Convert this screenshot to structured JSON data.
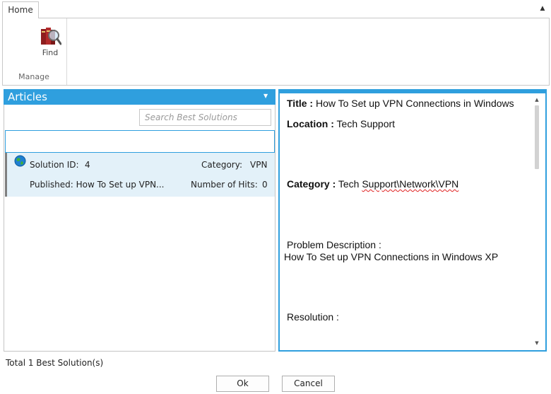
{
  "ribbon": {
    "tabs": [
      "Home"
    ],
    "collapse_icon": "chevron-up-icon",
    "find_label": "Find",
    "find_icon": "books-magnifier-icon",
    "group_label": "Manage"
  },
  "articles": {
    "header": "Articles",
    "header_color": "#2f9fde",
    "search_placeholder": "Search Best Solutions",
    "search_value": "",
    "selected_row": {
      "icon": "globe-icon",
      "solution_id_label": "Solution ID:",
      "solution_id": "4",
      "category_label": "Category:",
      "category": "VPN",
      "published": "Published: How To Set up VPN...",
      "hits_label": "Number of Hits:",
      "hits": "0",
      "background": "#e3f1f9"
    }
  },
  "detail": {
    "title_label": "Title :",
    "title": "How To Set up VPN Connections in Windows",
    "location_label": "Location :",
    "location": "Tech Support",
    "category_label": "Category :",
    "category_prefix": "Tech ",
    "category_rest": "Support\\Network\\VPN",
    "problem_label": "Problem Description :",
    "problem": "How To Set up VPN Connections in Windows XP",
    "resolution_label": "Resolution :"
  },
  "footer": {
    "total": "Total 1 Best Solution(s)",
    "ok_label": "Ok",
    "cancel_label": "Cancel"
  }
}
